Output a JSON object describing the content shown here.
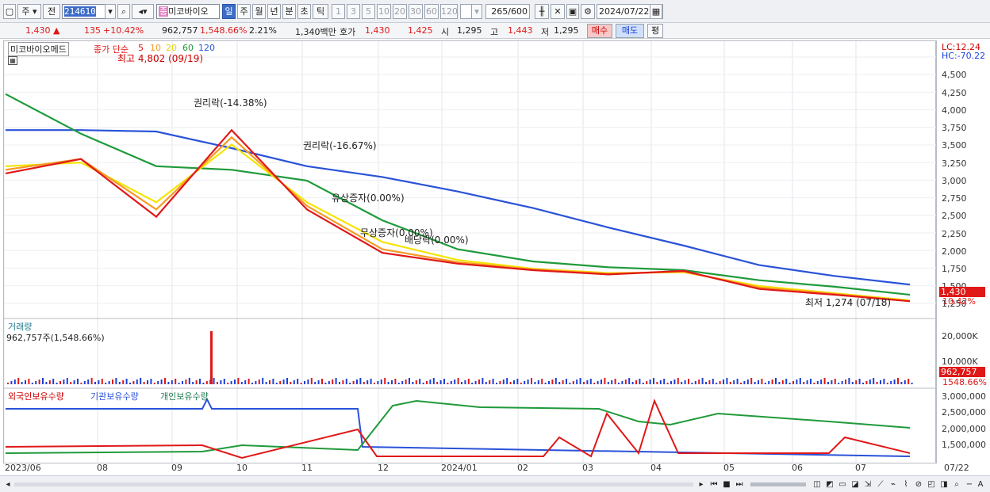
{
  "toolbar": {
    "type_label": "주",
    "prev_label": "전",
    "code": "214610",
    "stock_tag": "종",
    "stock_name": "미코바이오",
    "periods": [
      "일",
      "주",
      "월",
      "년",
      "분",
      "초",
      "틱"
    ],
    "intervals": [
      "1",
      "3",
      "5",
      "10",
      "20",
      "30",
      "60",
      "120"
    ],
    "count": "265",
    "count_total": "/600",
    "date": "2024/07/22"
  },
  "quote": {
    "price": "1,430 ▲",
    "change": "135",
    "change_pct": "+10.42%",
    "volume": "962,757",
    "volume_ratio": "1,548.66%",
    "turnover": "2.21%",
    "amount": "1,340백만",
    "ask_label": "호가",
    "ask1": "1,430",
    "ask2": "1,425",
    "open_label": "시",
    "open": "1,295",
    "high_label": "고",
    "high": "1,443",
    "low_label": "저",
    "low": "1,295",
    "buy_label": "매수",
    "sell_label": "매도",
    "eval_label": "평"
  },
  "price_panel": {
    "stock_label": "미코바이오메드",
    "ma_label": "종가 단순",
    "ma_periods": [
      "5",
      "10",
      "20",
      "60",
      "120"
    ],
    "high_note": "최고 4,802 (09/19)",
    "low_note": "최저 1,274 (07/18)",
    "events": [
      "권리락(-14.38%)",
      "권리락(-16.67%)",
      "유상증자(0.00%)",
      "무상증자(0.00%)",
      "배당락(0.00%)"
    ],
    "lc": "LC:12.24",
    "hc": "HC:-70.22",
    "y_ticks": [
      "4,500",
      "4,250",
      "4,000",
      "3,750",
      "3,500",
      "3,250",
      "3,000",
      "2,750",
      "2,500",
      "2,250",
      "2,000",
      "1,750",
      "1,500",
      "1,250"
    ],
    "cur_price": "1,430",
    "cur_pct": "10.42%"
  },
  "volume_panel": {
    "title": "거래량",
    "value": "962,757주(1,548.66%)",
    "y_ticks": [
      "20,000K",
      "10,000K"
    ],
    "cur_volume": "962,757",
    "cur_pct": "1548.66%"
  },
  "holdings_panel": {
    "titles": [
      "외국인보유수량",
      "기관보유수량",
      "개인보유수량"
    ],
    "y_ticks": [
      "3,000,000",
      "2,500,000",
      "2,000,000",
      "1,500,000"
    ]
  },
  "x_axis": [
    "2023/06",
    "08",
    "09",
    "10",
    "11",
    "12",
    "2024/01",
    "02",
    "03",
    "04",
    "05",
    "06",
    "07"
  ],
  "x_axis_last": "07/22",
  "colors": {
    "ma5": "#e01818",
    "ma10": "#f59a23",
    "ma20": "#f5e400",
    "ma60": "#1f9a3a",
    "ma120": "#2a52d8",
    "up": "#e01818",
    "down": "#1c3fd8"
  },
  "chart_data": {
    "type": "line",
    "x": [
      "2023/06",
      "08",
      "09",
      "10",
      "11",
      "12",
      "2024/01",
      "02",
      "03",
      "04",
      "05",
      "06",
      "07"
    ],
    "series": [
      {
        "name": "5",
        "values": [
          3100,
          3300,
          2500,
          3700,
          2600,
          2000,
          1850,
          1760,
          1700,
          1750,
          1500,
          1420,
          1330
        ]
      },
      {
        "name": "10",
        "values": [
          3150,
          3300,
          2600,
          3600,
          2650,
          2050,
          1870,
          1770,
          1710,
          1740,
          1520,
          1430,
          1330
        ]
      },
      {
        "name": "20",
        "values": [
          3200,
          3250,
          2700,
          3500,
          2700,
          2150,
          1900,
          1780,
          1720,
          1730,
          1540,
          1440,
          1340
        ]
      },
      {
        "name": "60",
        "values": [
          4200,
          3650,
          3200,
          3150,
          3000,
          2450,
          2050,
          1880,
          1800,
          1760,
          1620,
          1530,
          1420
        ]
      },
      {
        "name": "120",
        "values": [
          3700,
          3700,
          3680,
          3450,
          3200,
          3050,
          2850,
          2620,
          2350,
          2100,
          1830,
          1680,
          1560
        ]
      }
    ],
    "ylim": [
      1200,
      4800
    ]
  }
}
